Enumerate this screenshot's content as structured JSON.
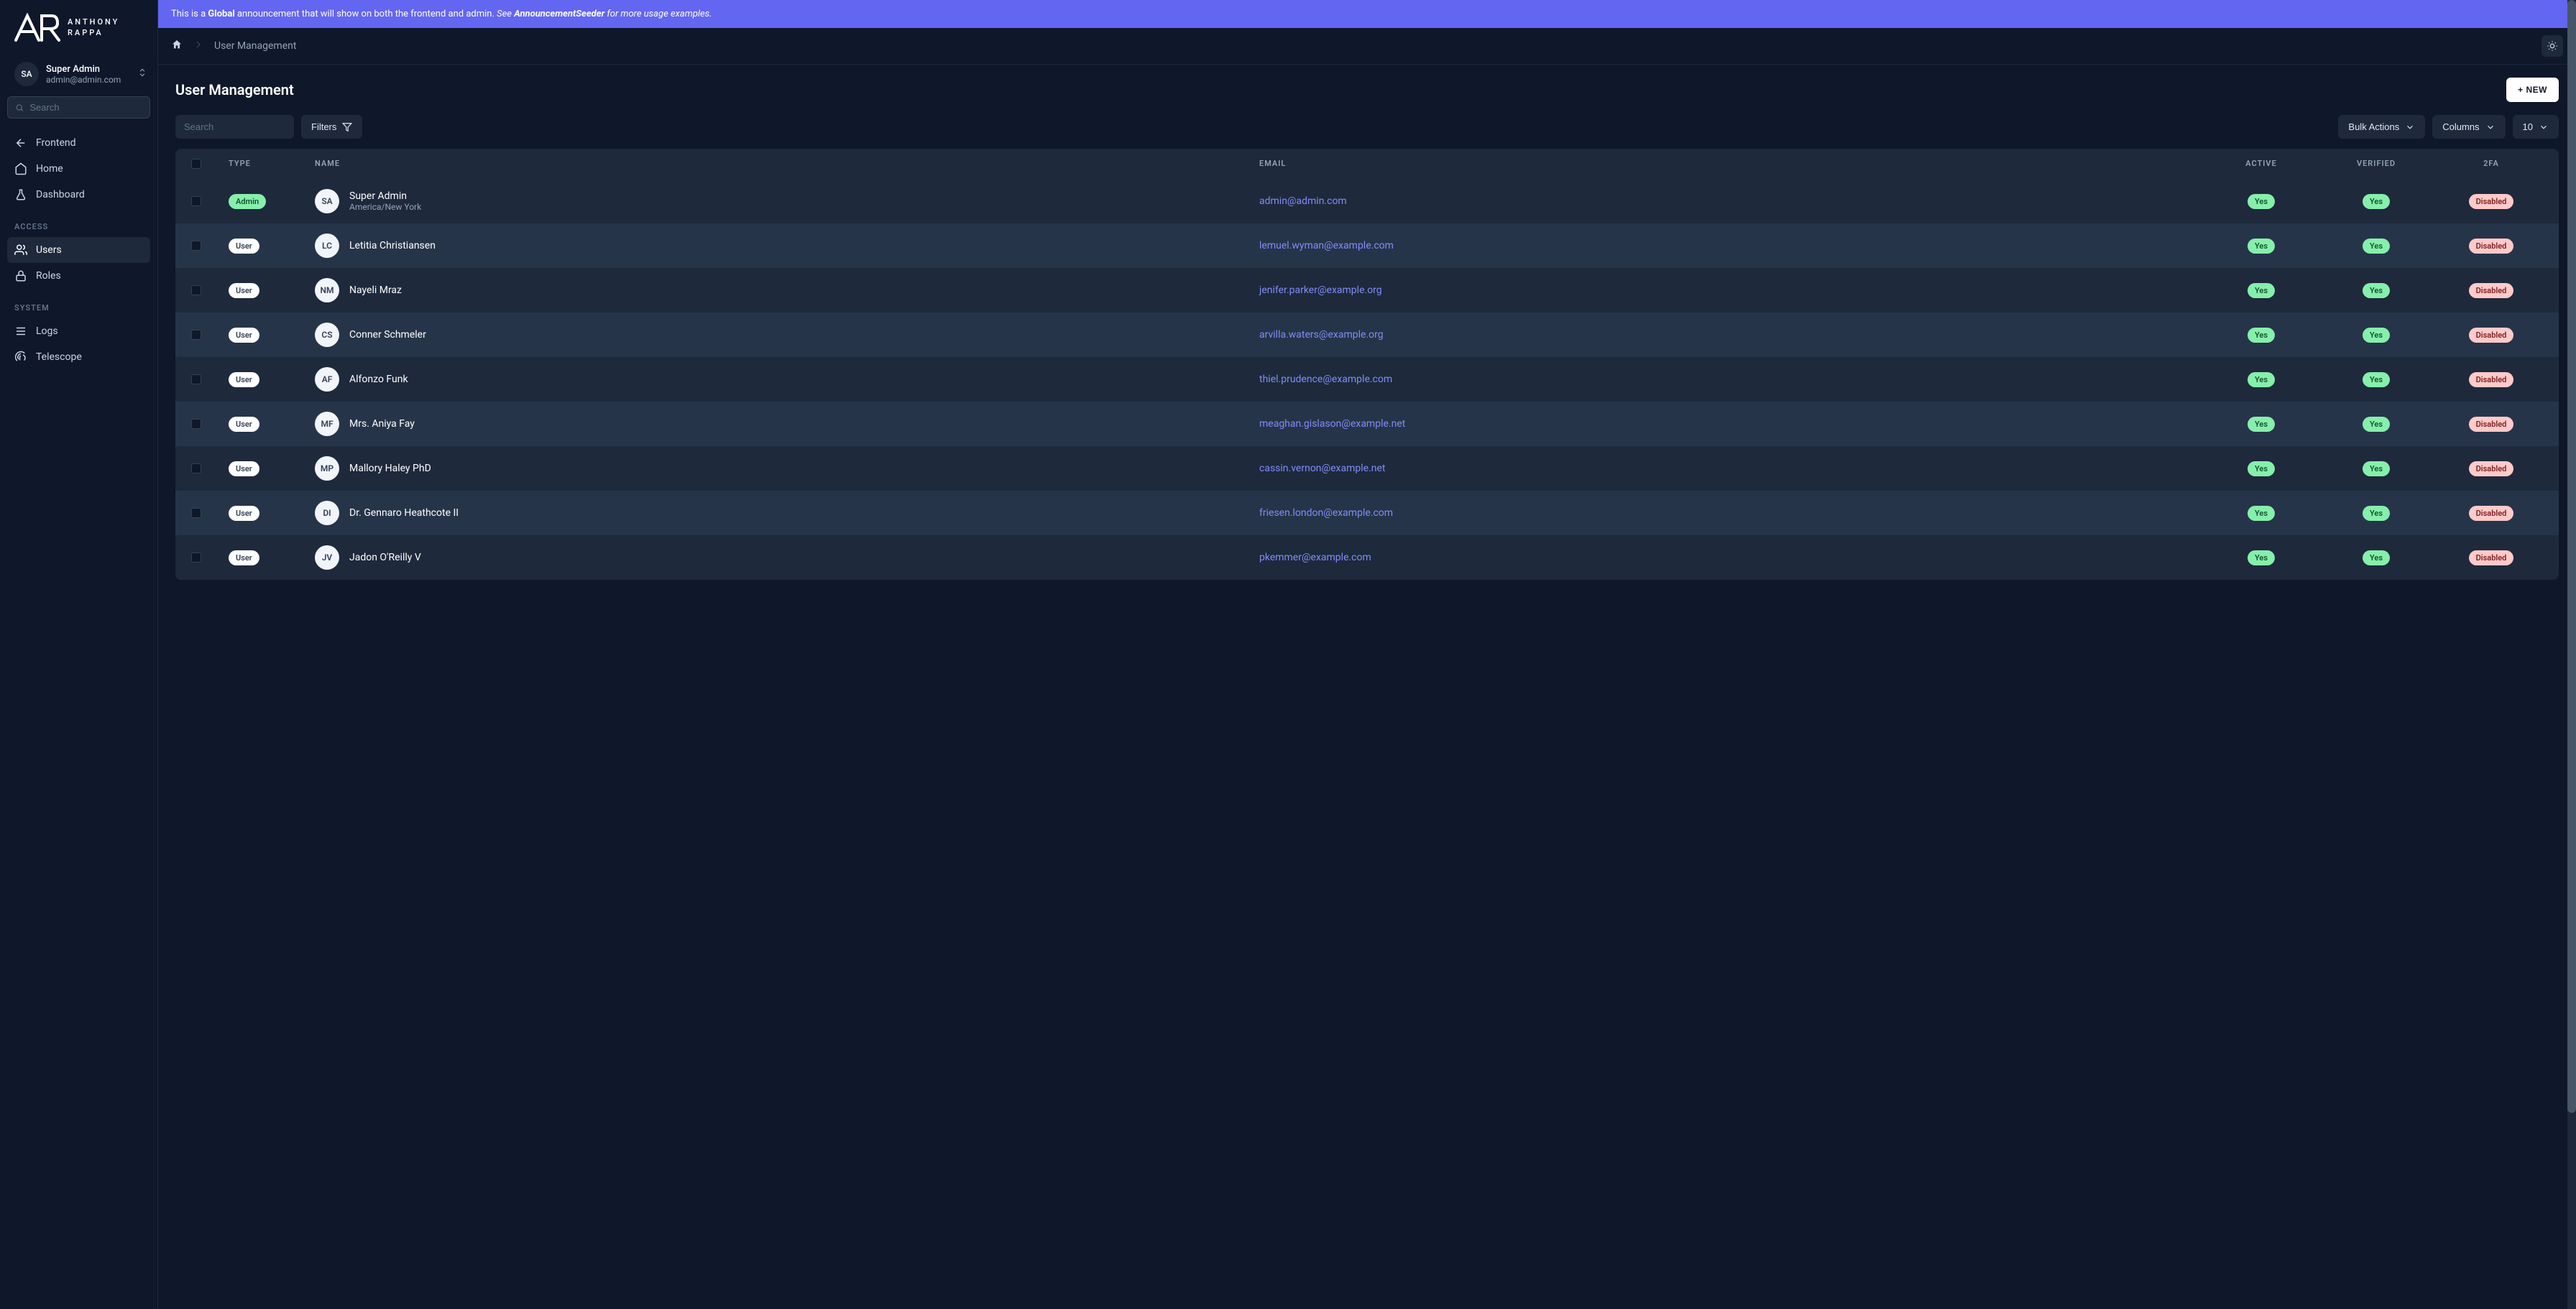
{
  "brand": {
    "line1": "ANTHONY",
    "line2": "RAPPA"
  },
  "current_user": {
    "initials": "SA",
    "name": "Super Admin",
    "email": "admin@admin.com"
  },
  "sidebar": {
    "search_placeholder": "Search",
    "items_top": [
      {
        "label": "Frontend"
      },
      {
        "label": "Home"
      },
      {
        "label": "Dashboard"
      }
    ],
    "heading_access": "ACCESS",
    "items_access": [
      {
        "label": "Users",
        "active": true
      },
      {
        "label": "Roles"
      }
    ],
    "heading_system": "SYSTEM",
    "items_system": [
      {
        "label": "Logs"
      },
      {
        "label": "Telescope"
      }
    ]
  },
  "announcement": {
    "prefix": "This is a ",
    "global": "Global",
    "mid": " announcement that will show on both the frontend and admin. ",
    "see": "See ",
    "seeder": "AnnouncementSeeder",
    "tail": " for more usage examples."
  },
  "breadcrumb": {
    "page": "User Management"
  },
  "page": {
    "title": "User Management",
    "new_button": "+ NEW"
  },
  "toolbar": {
    "search_placeholder": "Search",
    "filters": "Filters",
    "bulk": "Bulk Actions",
    "columns": "Columns",
    "page_size": "10"
  },
  "columns": {
    "type": "TYPE",
    "name": "NAME",
    "email": "EMAIL",
    "active": "ACTIVE",
    "verified": "VERIFIED",
    "two_fa": "2FA"
  },
  "badges": {
    "admin": "Admin",
    "user": "User",
    "yes": "Yes",
    "disabled": "Disabled"
  },
  "rows": [
    {
      "initials": "SA",
      "type": "admin",
      "name": "Super Admin",
      "sub": "America/New York",
      "email": "admin@admin.com",
      "active": "Yes",
      "verified": "Yes",
      "two_fa": "Disabled"
    },
    {
      "initials": "LC",
      "type": "user",
      "name": "Letitia Christiansen",
      "sub": "",
      "email": "lemuel.wyman@example.com",
      "active": "Yes",
      "verified": "Yes",
      "two_fa": "Disabled"
    },
    {
      "initials": "NM",
      "type": "user",
      "name": "Nayeli Mraz",
      "sub": "",
      "email": "jenifer.parker@example.org",
      "active": "Yes",
      "verified": "Yes",
      "two_fa": "Disabled"
    },
    {
      "initials": "CS",
      "type": "user",
      "name": "Conner Schmeler",
      "sub": "",
      "email": "arvilla.waters@example.org",
      "active": "Yes",
      "verified": "Yes",
      "two_fa": "Disabled"
    },
    {
      "initials": "AF",
      "type": "user",
      "name": "Alfonzo Funk",
      "sub": "",
      "email": "thiel.prudence@example.com",
      "active": "Yes",
      "verified": "Yes",
      "two_fa": "Disabled"
    },
    {
      "initials": "MF",
      "type": "user",
      "name": "Mrs. Aniya Fay",
      "sub": "",
      "email": "meaghan.gislason@example.net",
      "active": "Yes",
      "verified": "Yes",
      "two_fa": "Disabled"
    },
    {
      "initials": "MP",
      "type": "user",
      "name": "Mallory Haley PhD",
      "sub": "",
      "email": "cassin.vernon@example.net",
      "active": "Yes",
      "verified": "Yes",
      "two_fa": "Disabled"
    },
    {
      "initials": "DI",
      "type": "user",
      "name": "Dr. Gennaro Heathcote II",
      "sub": "",
      "email": "friesen.london@example.com",
      "active": "Yes",
      "verified": "Yes",
      "two_fa": "Disabled"
    },
    {
      "initials": "JV",
      "type": "user",
      "name": "Jadon O'Reilly V",
      "sub": "",
      "email": "pkemmer@example.com",
      "active": "Yes",
      "verified": "Yes",
      "two_fa": "Disabled"
    }
  ]
}
